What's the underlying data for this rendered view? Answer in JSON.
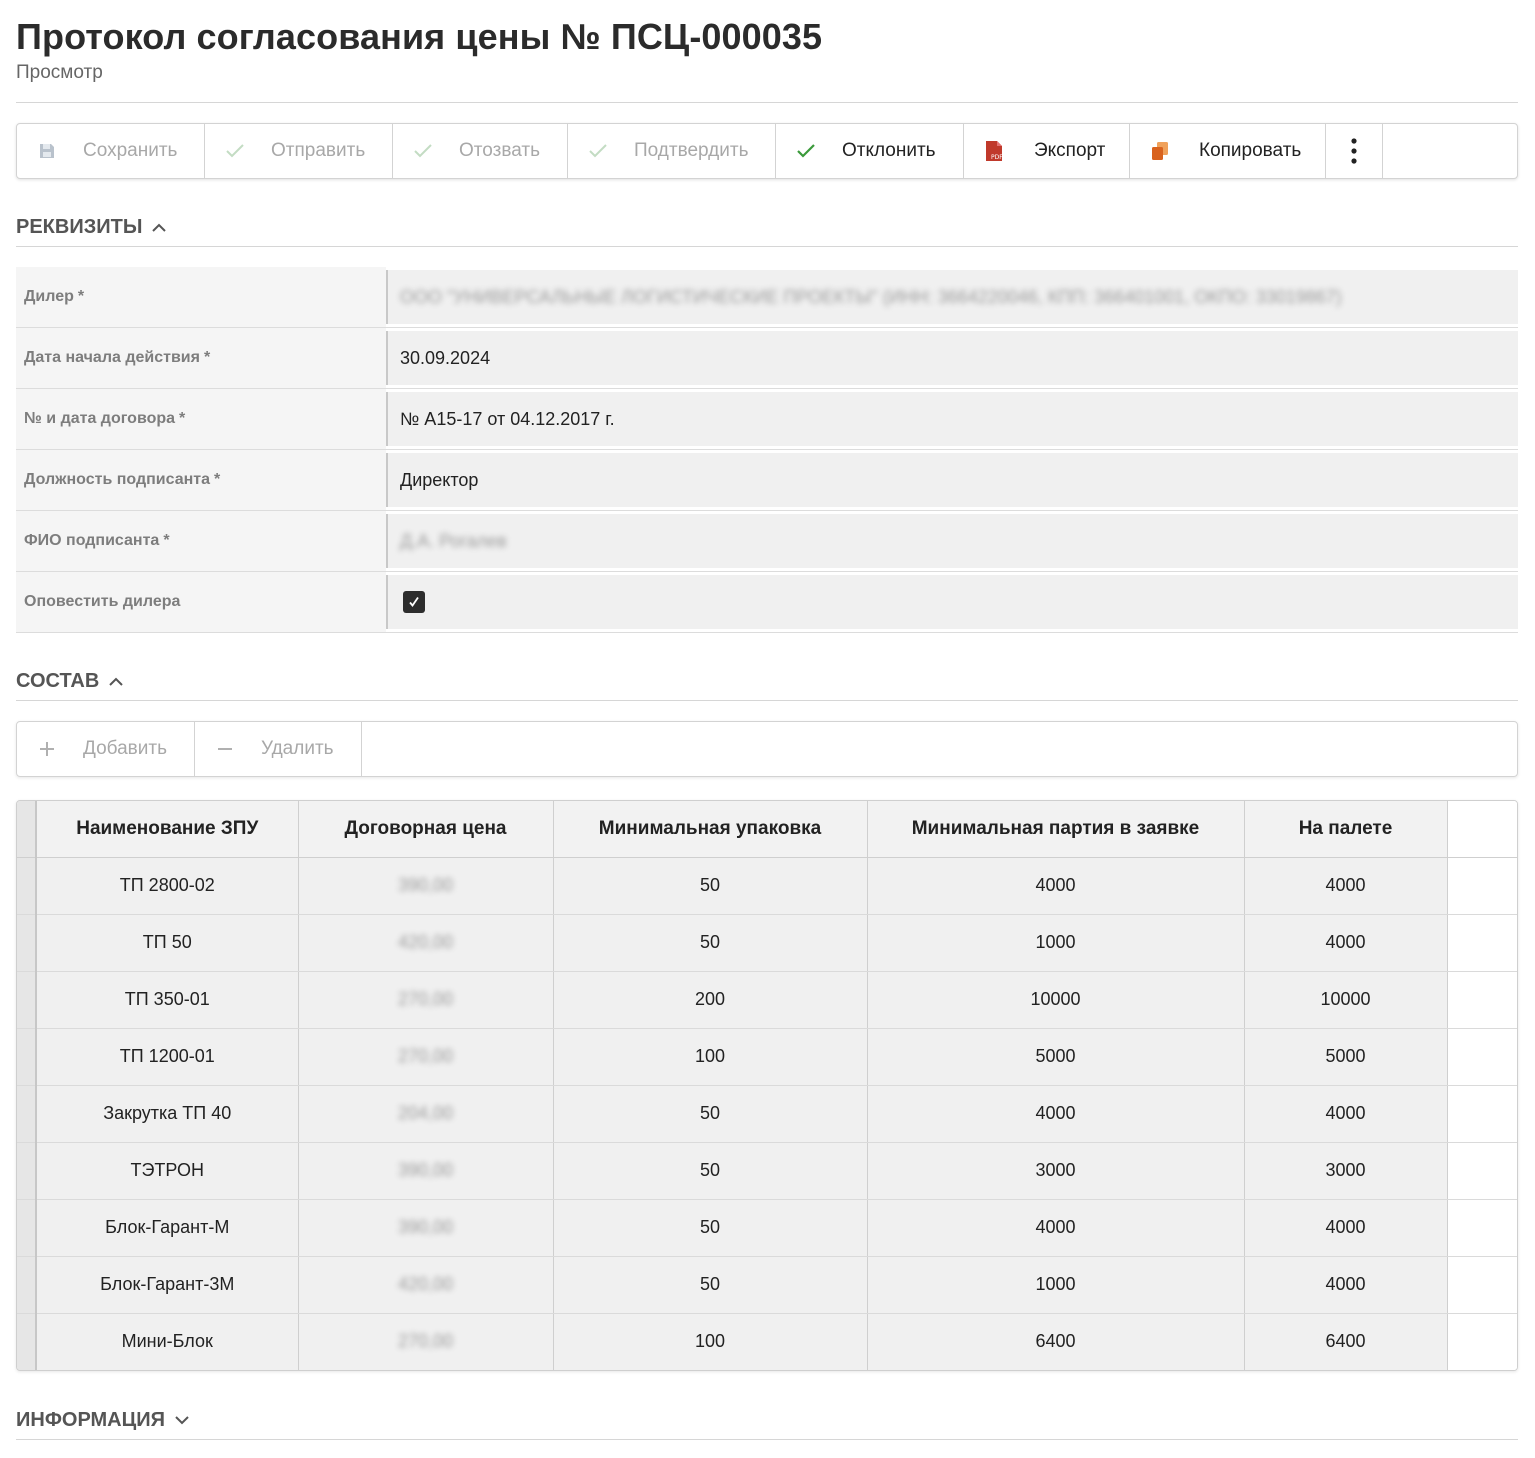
{
  "page": {
    "title": "Протокол согласования цены № ПСЦ-000035",
    "subtitle": "Просмотр"
  },
  "toolbar": {
    "save": "Сохранить",
    "send": "Отправить",
    "recall": "Отозвать",
    "confirm": "Подтвердить",
    "reject": "Отклонить",
    "export": "Экспорт",
    "copy": "Копировать",
    "pdf_label": "PDF"
  },
  "details": {
    "heading": "РЕКВИЗИТЫ",
    "required_mark": "*",
    "dealer_label": "Дилер",
    "dealer_value": "ООО \"УНИВЕРСАЛЬНЫЕ ЛОГИСТИЧЕСКИЕ ПРОЕКТЫ\" (ИНН: 3664220046, КПП: 366401001, ОКПО: 33019867)",
    "start_date_label": "Дата начала действия",
    "start_date_value": "30.09.2024",
    "contract_label": "№ и дата договора",
    "contract_value": "№ А15-17 от 04.12.2017 г.",
    "signer_position_label": "Должность подписанта",
    "signer_position_value": "Директор",
    "signer_name_label": "ФИО подписанта",
    "signer_name_value": "Д.А. Рогалев",
    "notify_label": "Оповестить дилера",
    "notify_checked": true
  },
  "composition": {
    "heading": "СОСТАВ",
    "add": "Добавить",
    "remove": "Удалить",
    "columns": [
      "Наименование ЗПУ",
      "Договорная цена",
      "Минимальная упаковка",
      "Минимальная партия в заявке",
      "На палете"
    ],
    "rows": [
      {
        "name": "ТП 2800-02",
        "price": "390,00",
        "min_pack": "50",
        "min_batch": "4000",
        "pallet": "4000"
      },
      {
        "name": "ТП 50",
        "price": "420,00",
        "min_pack": "50",
        "min_batch": "1000",
        "pallet": "4000"
      },
      {
        "name": "ТП 350-01",
        "price": "270,00",
        "min_pack": "200",
        "min_batch": "10000",
        "pallet": "10000"
      },
      {
        "name": "ТП 1200-01",
        "price": "270,00",
        "min_pack": "100",
        "min_batch": "5000",
        "pallet": "5000"
      },
      {
        "name": "Закрутка ТП 40",
        "price": "204,00",
        "min_pack": "50",
        "min_batch": "4000",
        "pallet": "4000"
      },
      {
        "name": "ТЭТРОН",
        "price": "390,00",
        "min_pack": "50",
        "min_batch": "3000",
        "pallet": "3000"
      },
      {
        "name": "Блок-Гарант-М",
        "price": "390,00",
        "min_pack": "50",
        "min_batch": "4000",
        "pallet": "4000"
      },
      {
        "name": "Блок-Гарант-3М",
        "price": "420,00",
        "min_pack": "50",
        "min_batch": "1000",
        "pallet": "4000"
      },
      {
        "name": "Мини-Блок",
        "price": "270,00",
        "min_pack": "100",
        "min_batch": "6400",
        "pallet": "6400"
      }
    ]
  },
  "info": {
    "heading": "ИНФОРМАЦИЯ"
  }
}
